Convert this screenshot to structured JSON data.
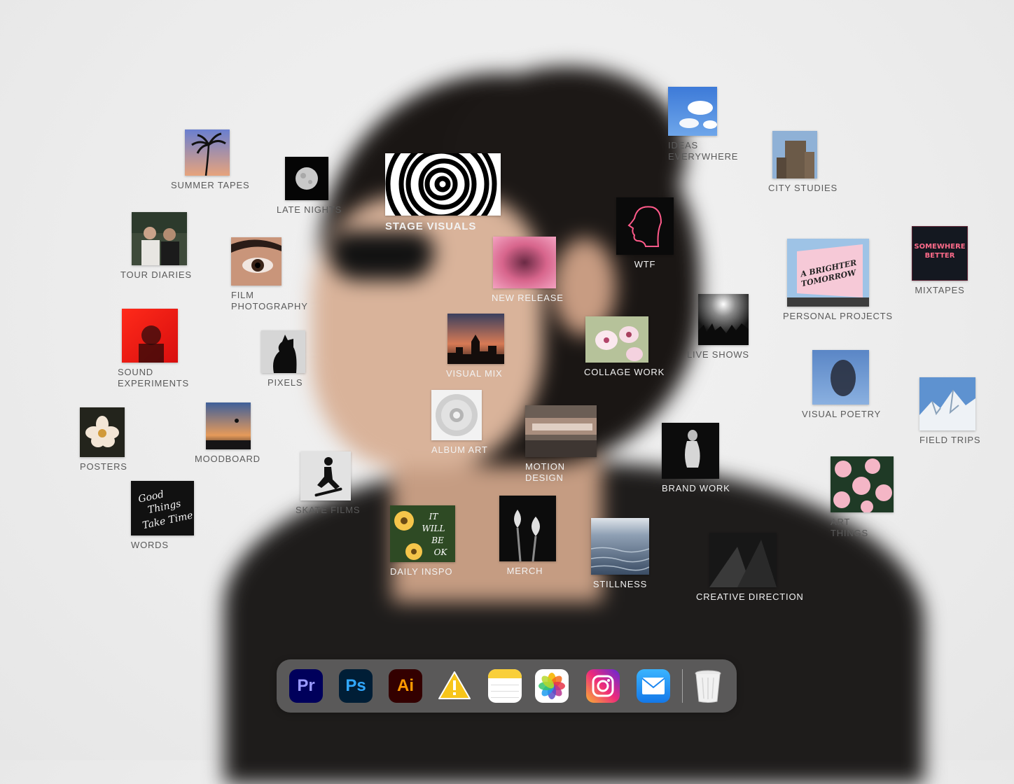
{
  "folders": {
    "summer_tapes": "SUMMER TAPES",
    "late_nights": "LATE NIGHTS",
    "stage_visuals": "STAGE VISUALS",
    "ideas_everywhere": "IDEAS\nEVERYWHERE",
    "city_studies": "CITY STUDIES",
    "tour_diaries": "TOUR DIARIES",
    "film_photography": "FILM\nPHOTOGRAPHY",
    "wtf": "WTF",
    "new_release": "NEW RELEASE",
    "personal_projects": "PERSONAL PROJECTS",
    "mixtapes": "MIXTAPES",
    "sound_experiments": "SOUND\nEXPERIMENTS",
    "pixels": "PIXELS",
    "visual_mix": "VISUAL MIX",
    "collage_work": "COLLAGE WORK",
    "live_shows": "LIVE SHOWS",
    "visual_poetry": "VISUAL POETRY",
    "field_trips": "FIELD TRIPS",
    "posters": "POSTERS",
    "moodboard": "MOODBOARD",
    "album_art": "ALBUM ART",
    "motion_design": "MOTION\nDESIGN",
    "brand_work": "BRAND WORK",
    "skate_films": "SKATE FILMS",
    "art_things": "ART\nTHINGS",
    "words": "WORDS",
    "daily_inspo": "DAILY INSPO",
    "merch": "MERCH",
    "stillness": "STILLNESS",
    "creative_direction": "CREATIVE DIRECTION"
  },
  "thumb_text": {
    "words_quote": "Good Things Take Time",
    "daily_inspo_quote": "IT WILL BE OK",
    "mixtapes_sign": "SOMEWHERE BETTER",
    "billboard": "A BRIGHTER TOMORROW"
  },
  "dock": {
    "premiere": {
      "text": "Pr",
      "icon": "premiere-pro-icon"
    },
    "photoshop": {
      "text": "Ps",
      "icon": "photoshop-icon"
    },
    "illustrator": {
      "text": "Ai",
      "icon": "illustrator-icon"
    },
    "warning": {
      "icon": "warning-icon"
    },
    "notes": {
      "icon": "notes-icon"
    },
    "photos": {
      "icon": "photos-icon"
    },
    "instagram": {
      "icon": "instagram-icon"
    },
    "mail": {
      "icon": "mail-icon"
    },
    "trash": {
      "icon": "trash-icon"
    }
  },
  "colors": {
    "premiere_bg": "#00005b",
    "premiere_fg": "#9999ff",
    "photoshop_bg": "#001e36",
    "photoshop_fg": "#31a8ff",
    "illustrator_bg": "#330000",
    "illustrator_fg": "#ff9a00",
    "label_dark": "#5a5a5a",
    "label_light": "#f2f2f2"
  }
}
